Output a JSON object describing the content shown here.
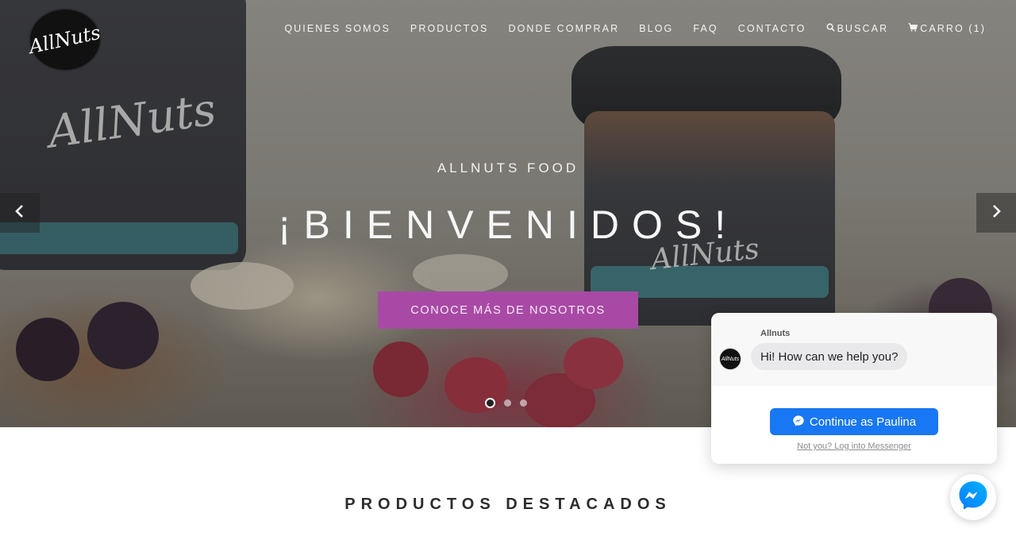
{
  "brand": {
    "logo_text": "AllNuts"
  },
  "nav": {
    "items": [
      {
        "label": "QUIENES SOMOS"
      },
      {
        "label": "PRODUCTOS"
      },
      {
        "label": "DONDE COMPRAR"
      },
      {
        "label": "BLOG"
      },
      {
        "label": "FAQ"
      },
      {
        "label": "CONTACTO"
      }
    ],
    "search_label": "BUSCAR",
    "search_icon": "search-icon",
    "cart_label": "CARRO (1)",
    "cart_icon": "cart-icon"
  },
  "hero": {
    "kicker": "ALLNUTS FOOD",
    "title": "¡BIENVENIDOS!",
    "cta": "CONOCE MÁS DE NOSOTROS",
    "prev_icon": "chevron-left-icon",
    "next_icon": "chevron-right-icon",
    "slides_total": 3,
    "active_slide": 1
  },
  "featured": {
    "title": "PRODUCTOS DESTACADOS"
  },
  "chat": {
    "page_name": "Allnuts",
    "greeting": "Hi! How can we help you?",
    "continue_label": "Continue as Paulina",
    "alt_link": "Not you? Log into Messenger",
    "brand_color": "#1877f2"
  },
  "colors": {
    "cta": "#a84aa5",
    "messenger": "#1877f2"
  }
}
